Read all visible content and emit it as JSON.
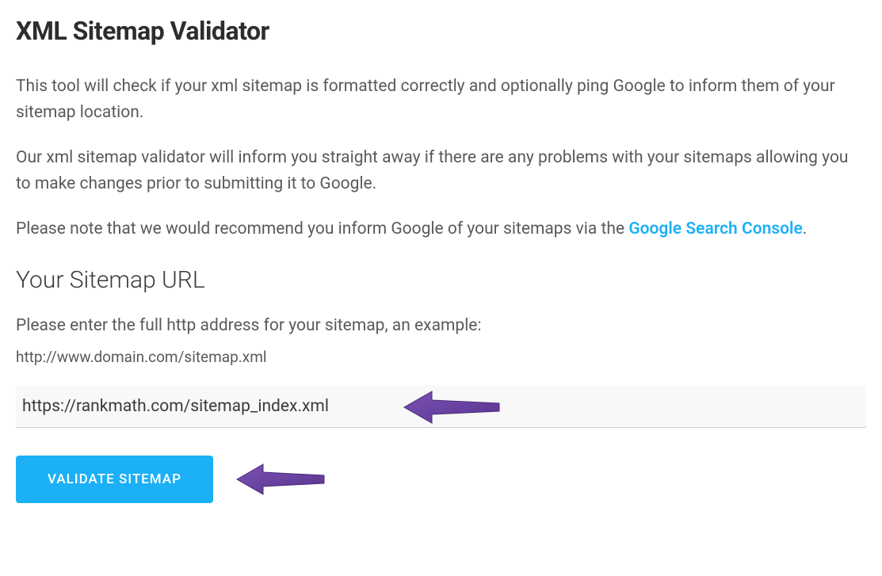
{
  "page": {
    "title": "XML Sitemap Validator",
    "description1": "This tool will check if your xml sitemap is formatted correctly and optionally ping Google to inform them of your sitemap location.",
    "description2": "Our xml sitemap validator will inform you straight away if there are any problems with your sitemaps allowing you to make changes prior to submitting it to Google.",
    "description3_prefix": "Please note that we would recommend you inform Google of your sitemaps via the ",
    "description3_link": "Google Search Console",
    "description3_suffix": "."
  },
  "form": {
    "section_title": "Your Sitemap URL",
    "input_label": "Please enter the full http address for your sitemap, an example:",
    "example": "http://www.domain.com/sitemap.xml",
    "input_value": "https://rankmath.com/sitemap_index.xml",
    "button_label": "VALIDATE SITEMAP"
  },
  "colors": {
    "accent": "#1cb0f6",
    "arrow": "#6b3fa0"
  }
}
